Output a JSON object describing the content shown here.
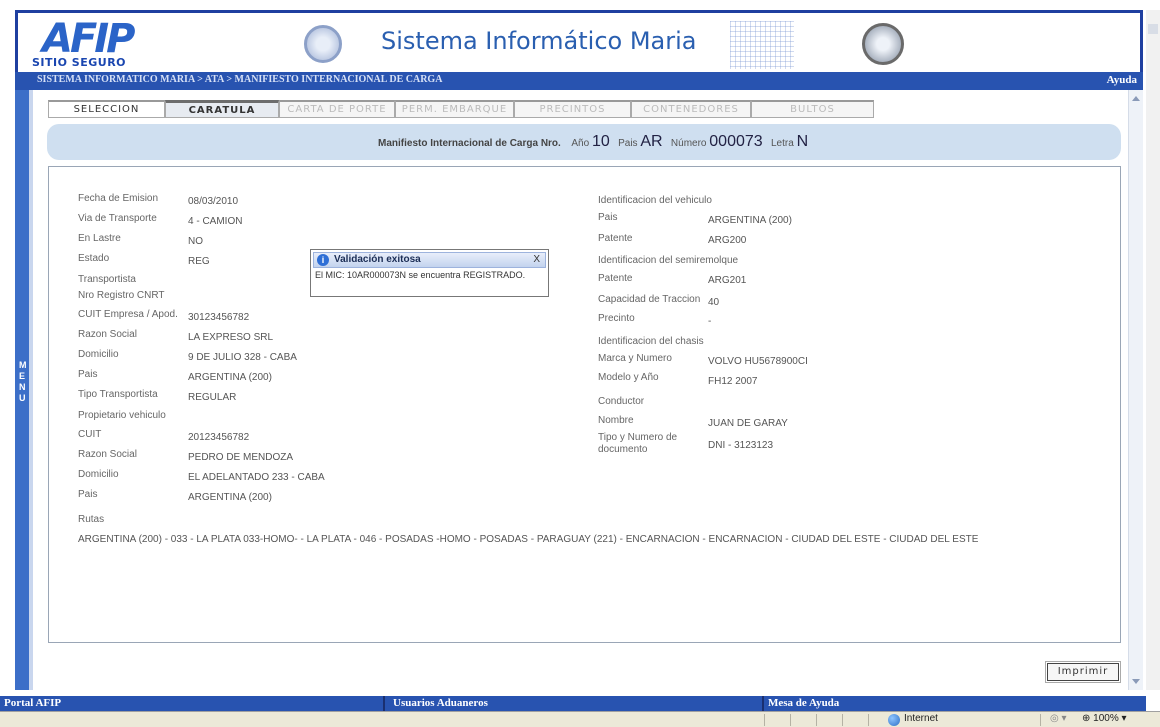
{
  "header": {
    "logo_text": "AFIP",
    "logo_subtitle": "SITIO SEGURO",
    "app_title": "Sistema Informático Maria"
  },
  "breadcrumb": {
    "text": "SISTEMA INFORMATICO MARIA > ATA > MANIFIESTO INTERNACIONAL DE CARGA",
    "help": "Ayuda"
  },
  "menu": {
    "letters": [
      "M",
      "E",
      "N",
      "U"
    ]
  },
  "tabs": [
    {
      "label": "SELECCION",
      "state": "enabled"
    },
    {
      "label": "CARATULA",
      "state": "current"
    },
    {
      "label": "CARTA DE PORTE",
      "state": "disabled"
    },
    {
      "label": "PERM. EMBARQUE",
      "state": "disabled"
    },
    {
      "label": "PRECINTOS",
      "state": "disabled"
    },
    {
      "label": "CONTENEDORES",
      "state": "disabled"
    },
    {
      "label": "BULTOS",
      "state": "disabled"
    }
  ],
  "manifest": {
    "label": "Manifiesto Internacional de Carga Nro.",
    "year_label": "Año",
    "year": "10",
    "country_label": "Pais",
    "country": "AR",
    "number_label": "Número",
    "number": "000073",
    "letter_label": "Letra",
    "letter": "N"
  },
  "left_fields": [
    {
      "label": "Fecha de Emision",
      "value": "08/03/2010"
    },
    {
      "label": "Via de Transporte",
      "value": "4 - CAMION"
    },
    {
      "label": "En Lastre",
      "value": "NO"
    },
    {
      "label": "Estado",
      "value": "REG"
    },
    {
      "label": "Transportista",
      "value": ""
    },
    {
      "label": "Nro Registro CNRT",
      "value": ""
    },
    {
      "label": "CUIT Empresa / Apod.",
      "value": "30123456782"
    },
    {
      "label": "Razon Social",
      "value": "LA EXPRESO SRL"
    },
    {
      "label": "Domicilio",
      "value": "9 DE JULIO 328 - CABA"
    },
    {
      "label": "Pais",
      "value": "ARGENTINA (200)"
    },
    {
      "label": "Tipo Transportista",
      "value": "REGULAR"
    },
    {
      "label": "Propietario vehiculo",
      "value": ""
    },
    {
      "label": "CUIT",
      "value": "20123456782"
    },
    {
      "label": "Razon Social",
      "value": "PEDRO DE MENDOZA"
    },
    {
      "label": "Domicilio",
      "value": "EL ADELANTADO 233 - CABA"
    },
    {
      "label": "Pais",
      "value": "ARGENTINA (200)"
    }
  ],
  "right_fields": [
    {
      "label": "Identificacion del vehiculo",
      "value": ""
    },
    {
      "label": "Pais",
      "value": "ARGENTINA (200)"
    },
    {
      "label": "Patente",
      "value": "ARG200"
    },
    {
      "label": "Identificacion del semiremolque",
      "value": ""
    },
    {
      "label": "Patente",
      "value": "ARG201"
    },
    {
      "label": "Capacidad de Traccion",
      "value": "40"
    },
    {
      "label": "Precinto",
      "value": "-"
    },
    {
      "label": "Identificacion del chasis",
      "value": ""
    },
    {
      "label": "Marca y Numero",
      "value": "VOLVO HU5678900CI"
    },
    {
      "label": "Modelo y Año",
      "value": "FH12 2007"
    },
    {
      "label": "Conductor",
      "value": ""
    },
    {
      "label": "Nombre",
      "value": "JUAN DE GARAY"
    },
    {
      "label": "Tipo y Numero de documento",
      "value": "DNI - 3123123"
    }
  ],
  "routes": {
    "label": "Rutas",
    "value": "ARGENTINA (200) - 033 - LA PLATA 033-HOMO- - LA PLATA - 046 - POSADAS -HOMO - POSADAS - PARAGUAY (221) - ENCARNACION - ENCARNACION - CIUDAD DEL ESTE - CIUDAD DEL ESTE"
  },
  "popup": {
    "title": "Validación exitosa",
    "close": "X",
    "message": "El MIC: 10AR000073N se encuentra REGISTRADO."
  },
  "print_button": "Imprimir",
  "footer": {
    "portal": "Portal AFIP",
    "users": "Usuarios Aduaneros",
    "help_desk": "Mesa de Ayuda"
  },
  "status_bar": {
    "zone": "Internet",
    "zoom": "100%"
  },
  "colors": {
    "brand_blue": "#2853b0",
    "header_panel": "#cfdff0",
    "popup_icon": "#2f6fd6"
  }
}
